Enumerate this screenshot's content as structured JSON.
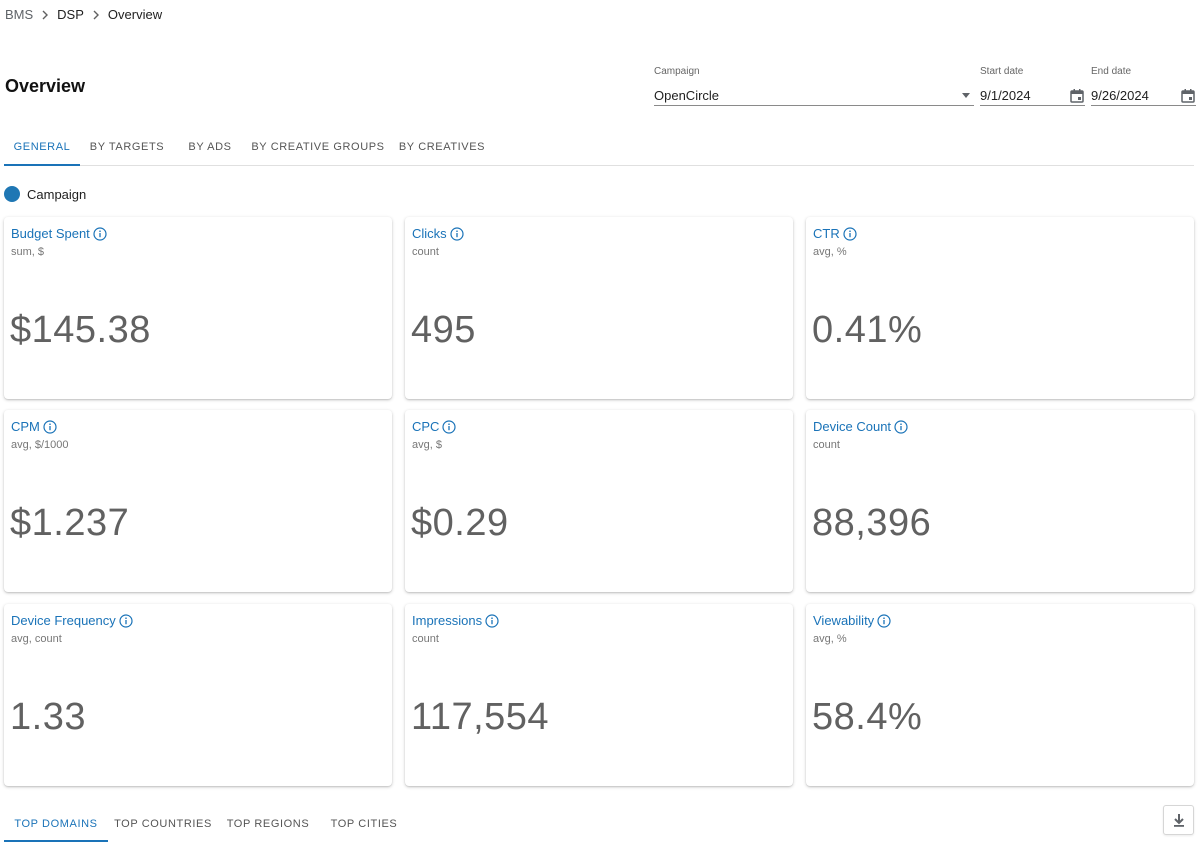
{
  "breadcrumb": {
    "items": [
      "BMS",
      "DSP",
      "Overview"
    ]
  },
  "page": {
    "title": "Overview"
  },
  "filters": {
    "campaign": {
      "label": "Campaign",
      "value": "OpenCircle"
    },
    "start_date": {
      "label": "Start date",
      "value": "9/1/2024"
    },
    "end_date": {
      "label": "End date",
      "value": "9/26/2024"
    }
  },
  "tabs": [
    {
      "label": "GENERAL",
      "active": true
    },
    {
      "label": "BY TARGETS",
      "active": false
    },
    {
      "label": "BY ADS",
      "active": false
    },
    {
      "label": "BY CREATIVE GROUPS",
      "active": false
    },
    {
      "label": "BY CREATIVES",
      "active": false
    }
  ],
  "legend": {
    "label": "Campaign",
    "color": "#1f77b4"
  },
  "metrics": [
    {
      "title": "Budget Spent",
      "subtitle": "sum, $",
      "value": "$145.38"
    },
    {
      "title": "Clicks",
      "subtitle": "count",
      "value": "495"
    },
    {
      "title": "CTR",
      "subtitle": "avg, %",
      "value": "0.41%"
    },
    {
      "title": "CPM",
      "subtitle": "avg, $/1000",
      "value": "$1.237"
    },
    {
      "title": "CPC",
      "subtitle": "avg, $",
      "value": "$0.29"
    },
    {
      "title": "Device Count",
      "subtitle": "count",
      "value": "88,396"
    },
    {
      "title": "Device Frequency",
      "subtitle": "avg, count",
      "value": "1.33"
    },
    {
      "title": "Impressions",
      "subtitle": "count",
      "value": "117,554"
    },
    {
      "title": "Viewability",
      "subtitle": "avg, %",
      "value": "58.4%"
    }
  ],
  "bottom_tabs": [
    {
      "label": "TOP DOMAINS",
      "active": true
    },
    {
      "label": "TOP COUNTRIES",
      "active": false
    },
    {
      "label": "TOP REGIONS",
      "active": false
    },
    {
      "label": "TOP CITIES",
      "active": false
    }
  ],
  "icons": {
    "breadcrumb_separator": "chevron-right-icon",
    "dropdown": "caret-down-icon",
    "date": "calendar-icon",
    "metric_info": "info-icon",
    "export": "download-icon"
  },
  "colors": {
    "accent": "#1a73b8",
    "value_text": "#616161"
  }
}
